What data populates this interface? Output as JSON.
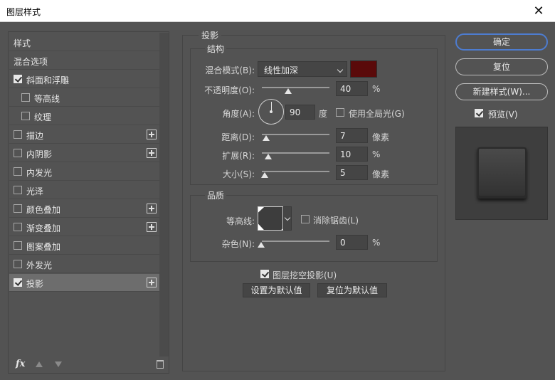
{
  "window": {
    "title": "图层样式",
    "close_glyph": "✕"
  },
  "styles_list": [
    {
      "label": "样式",
      "checkbox": false,
      "checked": false,
      "plus": false,
      "indent": false,
      "selected": false
    },
    {
      "label": "混合选项",
      "checkbox": false,
      "checked": false,
      "plus": false,
      "indent": false,
      "selected": false
    },
    {
      "label": "斜面和浮雕",
      "checkbox": true,
      "checked": true,
      "plus": false,
      "indent": false,
      "selected": false
    },
    {
      "label": "等高线",
      "checkbox": true,
      "checked": false,
      "plus": false,
      "indent": true,
      "selected": false
    },
    {
      "label": "纹理",
      "checkbox": true,
      "checked": false,
      "plus": false,
      "indent": true,
      "selected": false
    },
    {
      "label": "描边",
      "checkbox": true,
      "checked": false,
      "plus": true,
      "indent": false,
      "selected": false
    },
    {
      "label": "内阴影",
      "checkbox": true,
      "checked": false,
      "plus": true,
      "indent": false,
      "selected": false
    },
    {
      "label": "内发光",
      "checkbox": true,
      "checked": false,
      "plus": false,
      "indent": false,
      "selected": false
    },
    {
      "label": "光泽",
      "checkbox": true,
      "checked": false,
      "plus": false,
      "indent": false,
      "selected": false
    },
    {
      "label": "颜色叠加",
      "checkbox": true,
      "checked": false,
      "plus": true,
      "indent": false,
      "selected": false
    },
    {
      "label": "渐变叠加",
      "checkbox": true,
      "checked": false,
      "plus": true,
      "indent": false,
      "selected": false
    },
    {
      "label": "图案叠加",
      "checkbox": true,
      "checked": false,
      "plus": false,
      "indent": false,
      "selected": false
    },
    {
      "label": "外发光",
      "checkbox": true,
      "checked": false,
      "plus": false,
      "indent": false,
      "selected": false
    },
    {
      "label": "投影",
      "checkbox": true,
      "checked": true,
      "plus": true,
      "indent": false,
      "selected": true
    }
  ],
  "bottom_tools": {
    "fx_label": "fx"
  },
  "drop_shadow": {
    "title": "投影",
    "structure": {
      "title": "结构",
      "blend_mode_label": "混合模式(B):",
      "blend_mode_value": "线性加深",
      "shadow_color": "#5a0a0a",
      "opacity_label": "不透明度(O):",
      "opacity_value": "40",
      "opacity_unit": "%",
      "angle_label": "角度(A):",
      "angle_value": "90",
      "angle_unit": "度",
      "global_light_label": "使用全局光(G)",
      "global_light_checked": false,
      "distance_label": "距离(D):",
      "distance_value": "7",
      "distance_unit": "像素",
      "spread_label": "扩展(R):",
      "spread_value": "10",
      "spread_unit": "%",
      "size_label": "大小(S):",
      "size_value": "5",
      "size_unit": "像素"
    },
    "quality": {
      "title": "品质",
      "contour_label": "等高线:",
      "antialias_label": "消除锯齿(L)",
      "antialias_checked": false,
      "noise_label": "杂色(N):",
      "noise_value": "0",
      "noise_unit": "%"
    },
    "knockout_label": "图层挖空投影(U)",
    "knockout_checked": true,
    "make_default_label": "设置为默认值",
    "reset_default_label": "复位为默认值"
  },
  "right": {
    "ok_label": "确定",
    "reset_label": "复位",
    "new_style_label": "新建样式(W)...",
    "preview_label": "预览(V)",
    "preview_checked": true
  }
}
